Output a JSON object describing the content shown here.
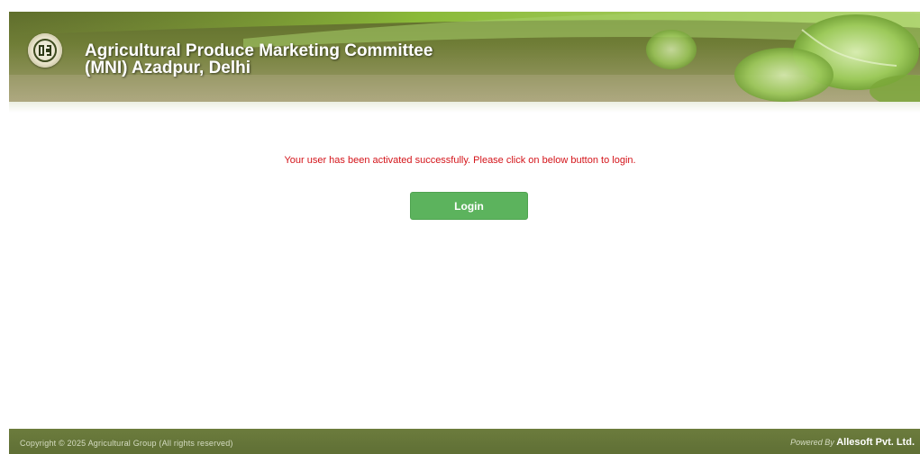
{
  "header": {
    "title_line1": "Agricultural Produce Marketing Committee",
    "title_line2": "(MNI) Azadpur, Delhi",
    "logo_icon": "apmc-emblem-icon"
  },
  "main": {
    "message": "Your user has been activated successfully. Please click on below button to login.",
    "login_label": "Login"
  },
  "footer": {
    "copyright": "Copyright © 2025 Agricultural Group (All rights reserved)",
    "powered_prefix": "Powered By",
    "powered_brand": "Allesoft Pvt. Ltd."
  },
  "colors": {
    "header": "#6f7d36",
    "message": "#d4141a",
    "button": "#5cb35d",
    "footer": "#657539"
  }
}
